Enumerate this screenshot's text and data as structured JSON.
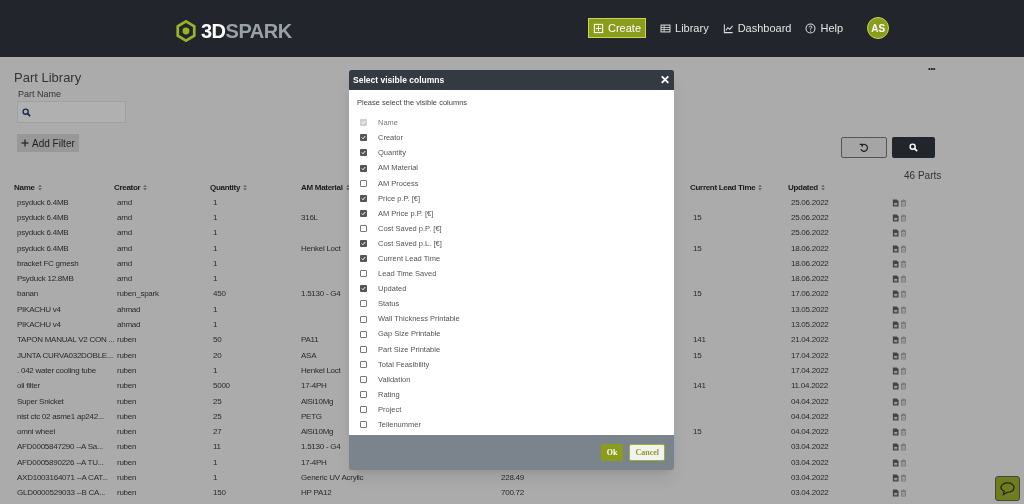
{
  "header": {
    "logo_prefix": "3D",
    "logo_suffix": "SPARK",
    "nav": [
      {
        "kind": "create",
        "label": "Create"
      },
      {
        "kind": "library",
        "label": "Library"
      },
      {
        "kind": "dashboard",
        "label": "Dashboard"
      },
      {
        "kind": "help",
        "label": "Help"
      }
    ],
    "avatar": "AS"
  },
  "page": {
    "title": "Part Library",
    "more": "•••",
    "filter_label": "Part Name",
    "add_filter": "Add Filter",
    "count": "46 Parts"
  },
  "table": {
    "columns": [
      "Name",
      "Creator",
      "Quantity",
      "AM Material",
      null,
      "Current Lead Time",
      "Updated"
    ],
    "rows": [
      [
        "psyduck 6.4MB",
        "arnd",
        "1",
        "",
        "",
        "",
        "25.06.2022"
      ],
      [
        "psyduck 6.4MB",
        "arnd",
        "1",
        "316L",
        "",
        "15",
        "25.06.2022"
      ],
      [
        "psyduck 6.4MB",
        "arnd",
        "1",
        "",
        "",
        "",
        "25.06.2022"
      ],
      [
        "psyduck 6.4MB",
        "arnd",
        "1",
        "Henkel Loct",
        "",
        "15",
        "18.06.2022"
      ],
      [
        "bracket FC gmesh",
        "arnd",
        "1",
        "",
        "",
        "",
        "18.06.2022"
      ],
      [
        "Psyduck 12.8MB",
        "arnd",
        "1",
        "",
        "",
        "",
        "18.06.2022"
      ],
      [
        "banan",
        "ruben_spark",
        "450",
        "1.5130 - G4",
        "",
        "15",
        "17.06.2022"
      ],
      [
        "PIKACHU v4",
        "ahmad",
        "1",
        "",
        "",
        "",
        "13.05.2022"
      ],
      [
        "PIKACHU v4",
        "ahmad",
        "1",
        "",
        "",
        "",
        "13.05.2022"
      ],
      [
        "TAPON MANUAL V2 CON ...",
        "ruben",
        "50",
        "PA11",
        "",
        "141",
        "21.04.2022"
      ],
      [
        "JUNTA CURVA032DOBLE...",
        "ruben",
        "20",
        "ASA",
        "",
        "15",
        "17.04.2022"
      ],
      [
        ". 042 water cooling tube",
        "ruben",
        "1",
        "Henkel Loct",
        "",
        "",
        "17.04.2022"
      ],
      [
        "oil filter",
        "ruben",
        "5000",
        "17-4PH",
        "",
        "141",
        "11.04.2022"
      ],
      [
        "Super Snicket",
        "ruben",
        "25",
        "AlSi10Mg",
        "",
        "",
        "04.04.2022"
      ],
      [
        "nist ctc 02 asme1 ap242...",
        "ruben",
        "25",
        "PETG",
        "",
        "",
        "04.04.2022"
      ],
      [
        "omni wheel",
        "ruben",
        "27",
        "AlSi10Mg",
        "",
        "15",
        "04.04.2022"
      ],
      [
        "AFD0005847290 --A Sa...",
        "ruben",
        "11",
        "1.5130 - G4",
        "",
        "",
        "03.04.2022"
      ],
      [
        "AFD0005890226 --A TU...",
        "ruben",
        "1",
        "17-4PH",
        "",
        "",
        "03.04.2022"
      ],
      [
        "AXD1003164071 --A CAT...",
        "ruben",
        "1",
        "Generic UV Acrylic",
        "228.49",
        "",
        "03.04.2022"
      ],
      [
        "GLD0000529033 --B CA...",
        "ruben",
        "150",
        "HP PA12",
        "700.72",
        "",
        "03.04.2022"
      ]
    ]
  },
  "dialog": {
    "title": "Select visible columns",
    "close": "✕",
    "prompt": "Please select the visible columns",
    "options": [
      {
        "label": "Name",
        "checked": true,
        "disabled": true
      },
      {
        "label": "Creator",
        "checked": true,
        "disabled": false
      },
      {
        "label": "Quantity",
        "checked": true,
        "disabled": false
      },
      {
        "label": "AM Material",
        "checked": true,
        "disabled": false
      },
      {
        "label": "AM Process",
        "checked": false,
        "disabled": false
      },
      {
        "label": "Price p.P. [€]",
        "checked": true,
        "disabled": false
      },
      {
        "label": "AM Price p.P. [€]",
        "checked": true,
        "disabled": false
      },
      {
        "label": "Cost Saved p.P. [€]",
        "checked": false,
        "disabled": false
      },
      {
        "label": "Cost Saved p.L. [€]",
        "checked": true,
        "disabled": false
      },
      {
        "label": "Current Lead Time",
        "checked": true,
        "disabled": false
      },
      {
        "label": "Lead Time Saved",
        "checked": false,
        "disabled": false
      },
      {
        "label": "Updated",
        "checked": true,
        "disabled": false
      },
      {
        "label": "Status",
        "checked": false,
        "disabled": false
      },
      {
        "label": "Wall Thickness Printable",
        "checked": false,
        "disabled": false
      },
      {
        "label": "Gap Size Printable",
        "checked": false,
        "disabled": false
      },
      {
        "label": "Part Size Printable",
        "checked": false,
        "disabled": false
      },
      {
        "label": "Total Feasibility",
        "checked": false,
        "disabled": false
      },
      {
        "label": "Validation",
        "checked": false,
        "disabled": false
      },
      {
        "label": "Rating",
        "checked": false,
        "disabled": false
      },
      {
        "label": "Project",
        "checked": false,
        "disabled": false
      },
      {
        "label": "Teilenummer",
        "checked": false,
        "disabled": false
      }
    ],
    "buttons": [
      "Ok",
      "Cancel"
    ]
  }
}
